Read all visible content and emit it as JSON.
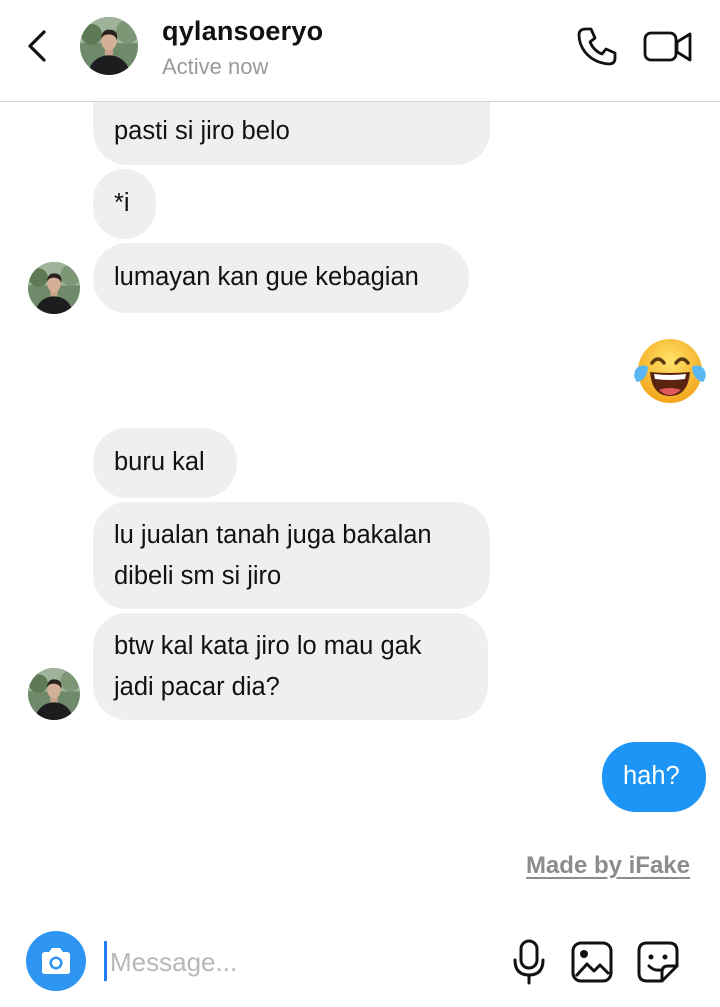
{
  "header": {
    "username": "qylansoeryo",
    "status": "Active now"
  },
  "messages": [
    {
      "direction": "incoming",
      "lines": [
        "pasti si jiro belo"
      ]
    },
    {
      "direction": "incoming",
      "lines": [
        "*i"
      ]
    },
    {
      "direction": "incoming",
      "lines": [
        "lumayan kan gue kebagian"
      ]
    },
    {
      "direction": "outgoing",
      "type": "emoji",
      "icon": "face-with-tears-of-joy-emoji"
    },
    {
      "direction": "incoming",
      "lines": [
        "buru kal"
      ]
    },
    {
      "direction": "incoming",
      "lines": [
        "lu jualan tanah juga bakalan",
        "dibeli sm si jiro"
      ]
    },
    {
      "direction": "incoming",
      "lines": [
        "btw kal kata jiro lo mau gak",
        "jadi pacar dia?"
      ]
    },
    {
      "direction": "outgoing",
      "lines": [
        "hah?"
      ]
    }
  ],
  "watermark": "Made by iFake",
  "composer": {
    "placeholder": "Message...",
    "icons": [
      "camera-icon",
      "microphone-icon",
      "gallery-icon",
      "sticker-icon"
    ]
  },
  "colors": {
    "incoming_bubble": "#efeff1",
    "outgoing_bubble": "#1d95f6",
    "camera_button": "#2e95f3",
    "secondary_text": "#9a9a9a"
  }
}
